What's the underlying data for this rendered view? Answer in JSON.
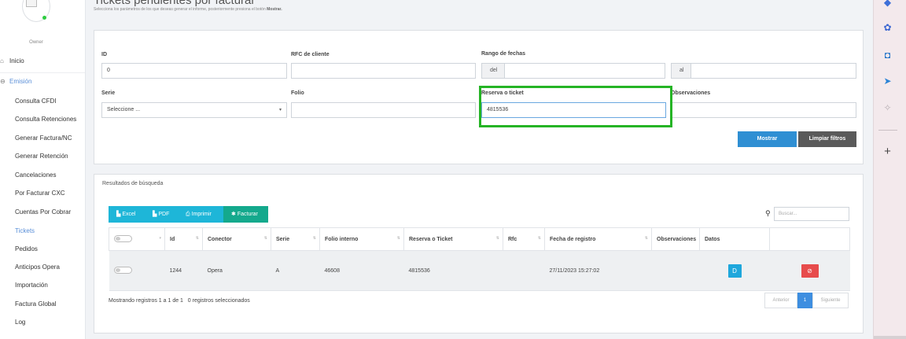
{
  "sidebar": {
    "role": "Owner",
    "top_items": [
      {
        "icon": "home-icon",
        "label": "Inicio"
      },
      {
        "icon": "circle-arrow-icon",
        "label": "Emisión"
      }
    ],
    "sub_items": [
      {
        "label": "Consulta CFDI"
      },
      {
        "label": "Consulta Retenciones"
      },
      {
        "label": "Generar Factura/NC"
      },
      {
        "label": "Generar Retención"
      },
      {
        "label": "Cancelaciones"
      },
      {
        "label": "Por Facturar CXC"
      },
      {
        "label": "Cuentas Por Cobrar"
      },
      {
        "label": "Tickets"
      },
      {
        "label": "Pedidos"
      },
      {
        "label": "Anticipos Opera"
      },
      {
        "label": "Importación"
      },
      {
        "label": "Factura Global"
      },
      {
        "label": "Log"
      }
    ],
    "active_item": "Tickets",
    "active_color": "#5a8fd8"
  },
  "header": {
    "title": "Tickets pendientes por facturar",
    "subtitle_pre": "Selecciona los parámetros de los que deseas generar el informe, posteriormente presiona el botón ",
    "subtitle_bold": "Mostrar."
  },
  "filters": {
    "id_label": "ID",
    "id_value": "0",
    "rfc_label": "RFC de cliente",
    "rfc_value": "",
    "fechas_label": "Rango de fechas",
    "del_label": "del",
    "al_label": "al",
    "serie_label": "Serie",
    "serie_value": "Seleccione ...",
    "folio_label": "Folio",
    "folio_value": "",
    "reserva_label": "Reserva o ticket",
    "reserva_value": "4815536",
    "observaciones_label": "Observaciones",
    "mostrar_label": "Mostrar",
    "limpiar_label": "Limpiar filtros"
  },
  "results": {
    "title": "Resultados de búsqueda",
    "toolbar": [
      {
        "icon": "file-excel-icon",
        "label": "Excel"
      },
      {
        "icon": "file-pdf-icon",
        "label": "PDF"
      },
      {
        "icon": "printer-icon",
        "label": "Imprimir"
      },
      {
        "icon": "gear-icon",
        "label": "Facturar"
      }
    ],
    "search_placeholder": "Buscar...",
    "columns": [
      "Id",
      "Conector",
      "Serie",
      "Folio interno",
      "Reserva o Ticket",
      "Rfc",
      "Fecha de registro",
      "Observaciones",
      "Datos"
    ],
    "rows": [
      {
        "id": "1244",
        "conector": "Opera",
        "serie": "A",
        "folio_interno": "46608",
        "reserva": "4815536",
        "rfc": "",
        "fecha": "27/11/2023 15:27:02",
        "observaciones": "",
        "datos_button": "D"
      }
    ],
    "showing_text": "Mostrando registros 1 a 1 de 1",
    "selected_text": "0 registros seleccionados",
    "pager": {
      "prev": "Anterior",
      "page": "1",
      "next": "Siguiente"
    }
  },
  "colors": {
    "focus_outline": "#25b425",
    "primary": "#2f8fd3",
    "danger": "#e74c4c"
  }
}
